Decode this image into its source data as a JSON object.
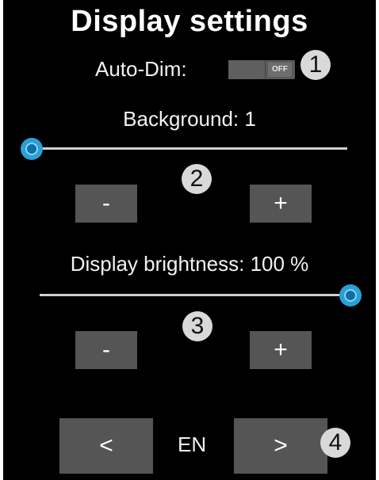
{
  "title": "Display settings",
  "auto_dim": {
    "label": "Auto-Dim:",
    "state_text": "OFF",
    "enabled": false
  },
  "background": {
    "label": "Background: 1",
    "value": 1,
    "minus_label": "-",
    "plus_label": "+"
  },
  "brightness": {
    "label": "Display brightness: 100 %",
    "value_percent": 100,
    "minus_label": "-",
    "plus_label": "+"
  },
  "language": {
    "prev_label": "<",
    "code": "EN",
    "next_label": ">"
  },
  "badges": [
    "1",
    "2",
    "3",
    "4"
  ],
  "colors": {
    "screen_bg": "#000000",
    "slider_accent": "#2aa0d8",
    "button_bg": "#555555",
    "badge_bg": "#d9d9d9"
  }
}
